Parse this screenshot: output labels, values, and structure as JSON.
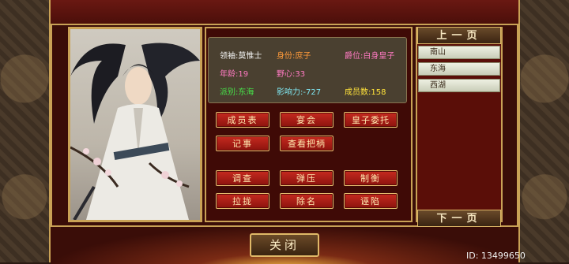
{
  "character": {
    "leader_label": "领袖:莫惟士",
    "identity_label": "身份:庶子",
    "title_label": "爵位:白身皇子",
    "age_label": "年龄:19",
    "ambition_label": "野心:33",
    "faction_label": "派别:东海",
    "influence_label": "影响力:-727",
    "members_label": "成员数:158"
  },
  "actions": {
    "member_list": "成员表",
    "banquet": "宴会",
    "prince_entrust": "皇子委托",
    "records": "记事",
    "check_leverage": "查看把柄",
    "investigate": "调查",
    "impeach": "弹压",
    "restrain": "制衡",
    "win_over": "拉拢",
    "expel": "除名",
    "frame": "诬陷"
  },
  "sidebar": {
    "prev_page": "上一页",
    "next_page": "下一页",
    "items": [
      "南山",
      "东海",
      "西湖"
    ]
  },
  "footer": {
    "close_label": "关闭",
    "id_text": "ID: 13499650"
  },
  "colors": {
    "white_text": "#f3f3f3",
    "orange_text": "#ff9a3a",
    "pink_text": "#ff7ac2",
    "green_text": "#47e64a",
    "cyan_text": "#7fe6f0",
    "yellow_text": "#ffe23a",
    "button_red": "#b8201a",
    "gold_border": "#c9a256"
  }
}
